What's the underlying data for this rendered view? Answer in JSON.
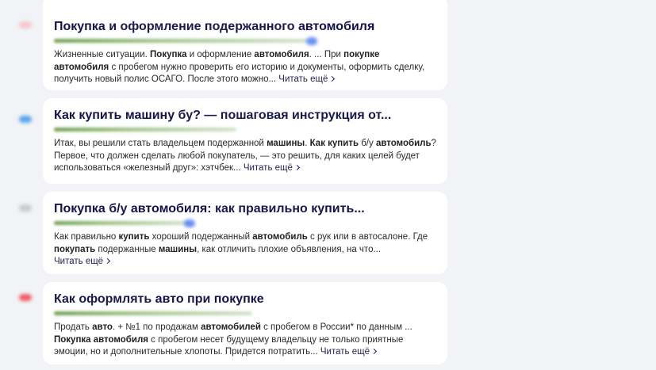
{
  "results": [
    {
      "title": [
        {
          "t": "Покупка",
          "b": true
        },
        {
          "t": " и оформление подержанного ",
          "b": false
        },
        {
          "t": "автомобиля",
          "b": true
        }
      ],
      "favicon_color": "#f4c8cc",
      "snippet": [
        {
          "t": "Жизненные ситуации. ",
          "b": false
        },
        {
          "t": "Покупка",
          "b": true
        },
        {
          "t": " и оформление ",
          "b": false
        },
        {
          "t": "автомобиля",
          "b": true
        },
        {
          "t": ". ... При ",
          "b": false
        },
        {
          "t": "покупке автомобиля",
          "b": true
        },
        {
          "t": " с пробегом нужно проверить его историю и документы, оформить сделку, получить новый полис ОСАГО. После этого можно...",
          "b": false
        }
      ],
      "read_more": "Читать ещё"
    },
    {
      "title": [
        {
          "t": "Как купить машину",
          "b": true
        },
        {
          "t": " бу? — пошаговая инструкция от...",
          "b": false
        }
      ],
      "favicon_color": "#5aa6f0",
      "snippet": [
        {
          "t": "Итак, вы решили стать владельцем подержанной ",
          "b": false
        },
        {
          "t": "машины",
          "b": true
        },
        {
          "t": ". ",
          "b": false
        },
        {
          "t": "Как купить",
          "b": true
        },
        {
          "t": " б/у ",
          "b": false
        },
        {
          "t": "автомобиль",
          "b": true
        },
        {
          "t": "? Первое, что должен сделать любой покупатель, — это решить, для каких целей будет использоваться «железный друг»: хэтчбек...",
          "b": false
        }
      ],
      "read_more": "Читать ещё"
    },
    {
      "title": [
        {
          "t": "Покупка",
          "b": true
        },
        {
          "t": " б/у ",
          "b": false
        },
        {
          "t": "автомобиля",
          "b": true
        },
        {
          "t": ": как правильно ",
          "b": false
        },
        {
          "t": "купить",
          "b": true
        },
        {
          "t": "...",
          "b": false
        }
      ],
      "favicon_color": "#c8cbd0",
      "snippet": [
        {
          "t": "Как правильно ",
          "b": false
        },
        {
          "t": "купить",
          "b": true
        },
        {
          "t": " хороший подержанный ",
          "b": false
        },
        {
          "t": "автомобиль",
          "b": true
        },
        {
          "t": " с рук или в автосалоне. Где ",
          "b": false
        },
        {
          "t": "покупать",
          "b": true
        },
        {
          "t": " подержанные ",
          "b": false
        },
        {
          "t": "машины",
          "b": true
        },
        {
          "t": ", как отличить плохие объявления, на что...",
          "b": false
        }
      ],
      "read_more": "Читать ещё"
    },
    {
      "title": [
        {
          "t": "Как оформлять ",
          "b": false
        },
        {
          "t": "авто",
          "b": true
        },
        {
          "t": " при ",
          "b": false
        },
        {
          "t": "покупке",
          "b": true
        }
      ],
      "favicon_color": "#ef5d6a",
      "snippet": [
        {
          "t": "Продать ",
          "b": false
        },
        {
          "t": "авто",
          "b": true
        },
        {
          "t": ". + №1 по продажам ",
          "b": false
        },
        {
          "t": "автомобилей",
          "b": true
        },
        {
          "t": " с пробегом в России* по данным ... ",
          "b": false
        },
        {
          "t": "Покупка автомобиля",
          "b": true
        },
        {
          "t": " с пробегом несет будущему владельцу не только приятные эмоции, но и дополнительные хлопоты. Придется потратить...",
          "b": false
        }
      ],
      "read_more": "Читать ещё"
    }
  ]
}
